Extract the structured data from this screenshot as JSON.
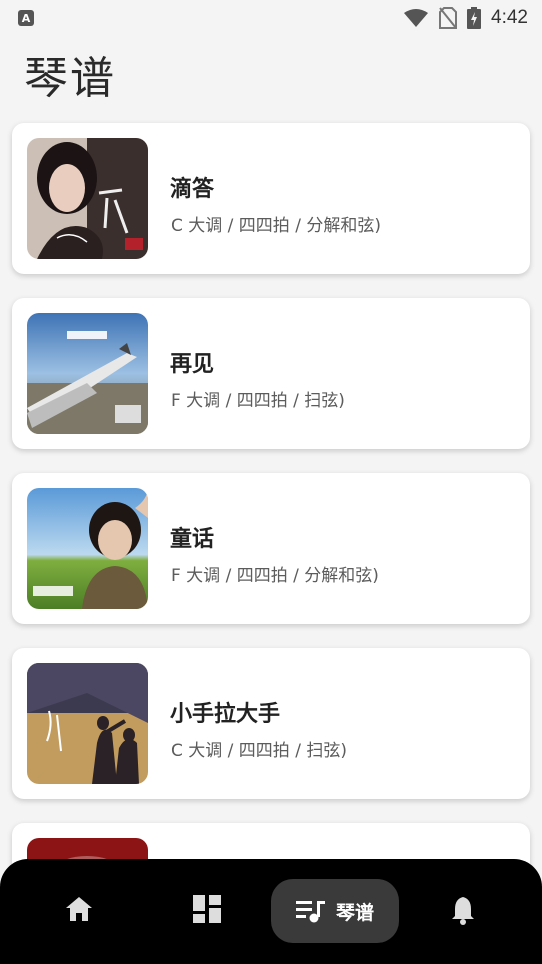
{
  "status_bar": {
    "time": "4:42",
    "app_indicator": "A"
  },
  "page": {
    "title": "琴谱"
  },
  "songs": [
    {
      "title": "滴答",
      "meta": "C 大调 / 四四拍 / 分解和弦)"
    },
    {
      "title": "再见",
      "meta": "F 大调 / 四四拍 / 扫弦)"
    },
    {
      "title": "童话",
      "meta": "F 大调 / 四四拍 / 分解和弦)"
    },
    {
      "title": "小手拉大手",
      "meta": "C 大调 / 四四拍 / 扫弦)"
    }
  ],
  "bottom_nav": {
    "items": [
      {
        "icon": "home-icon"
      },
      {
        "icon": "dashboard-icon"
      },
      {
        "icon": "music-sheet-icon",
        "label": "琴谱",
        "active": true
      },
      {
        "icon": "bell-icon"
      }
    ]
  }
}
